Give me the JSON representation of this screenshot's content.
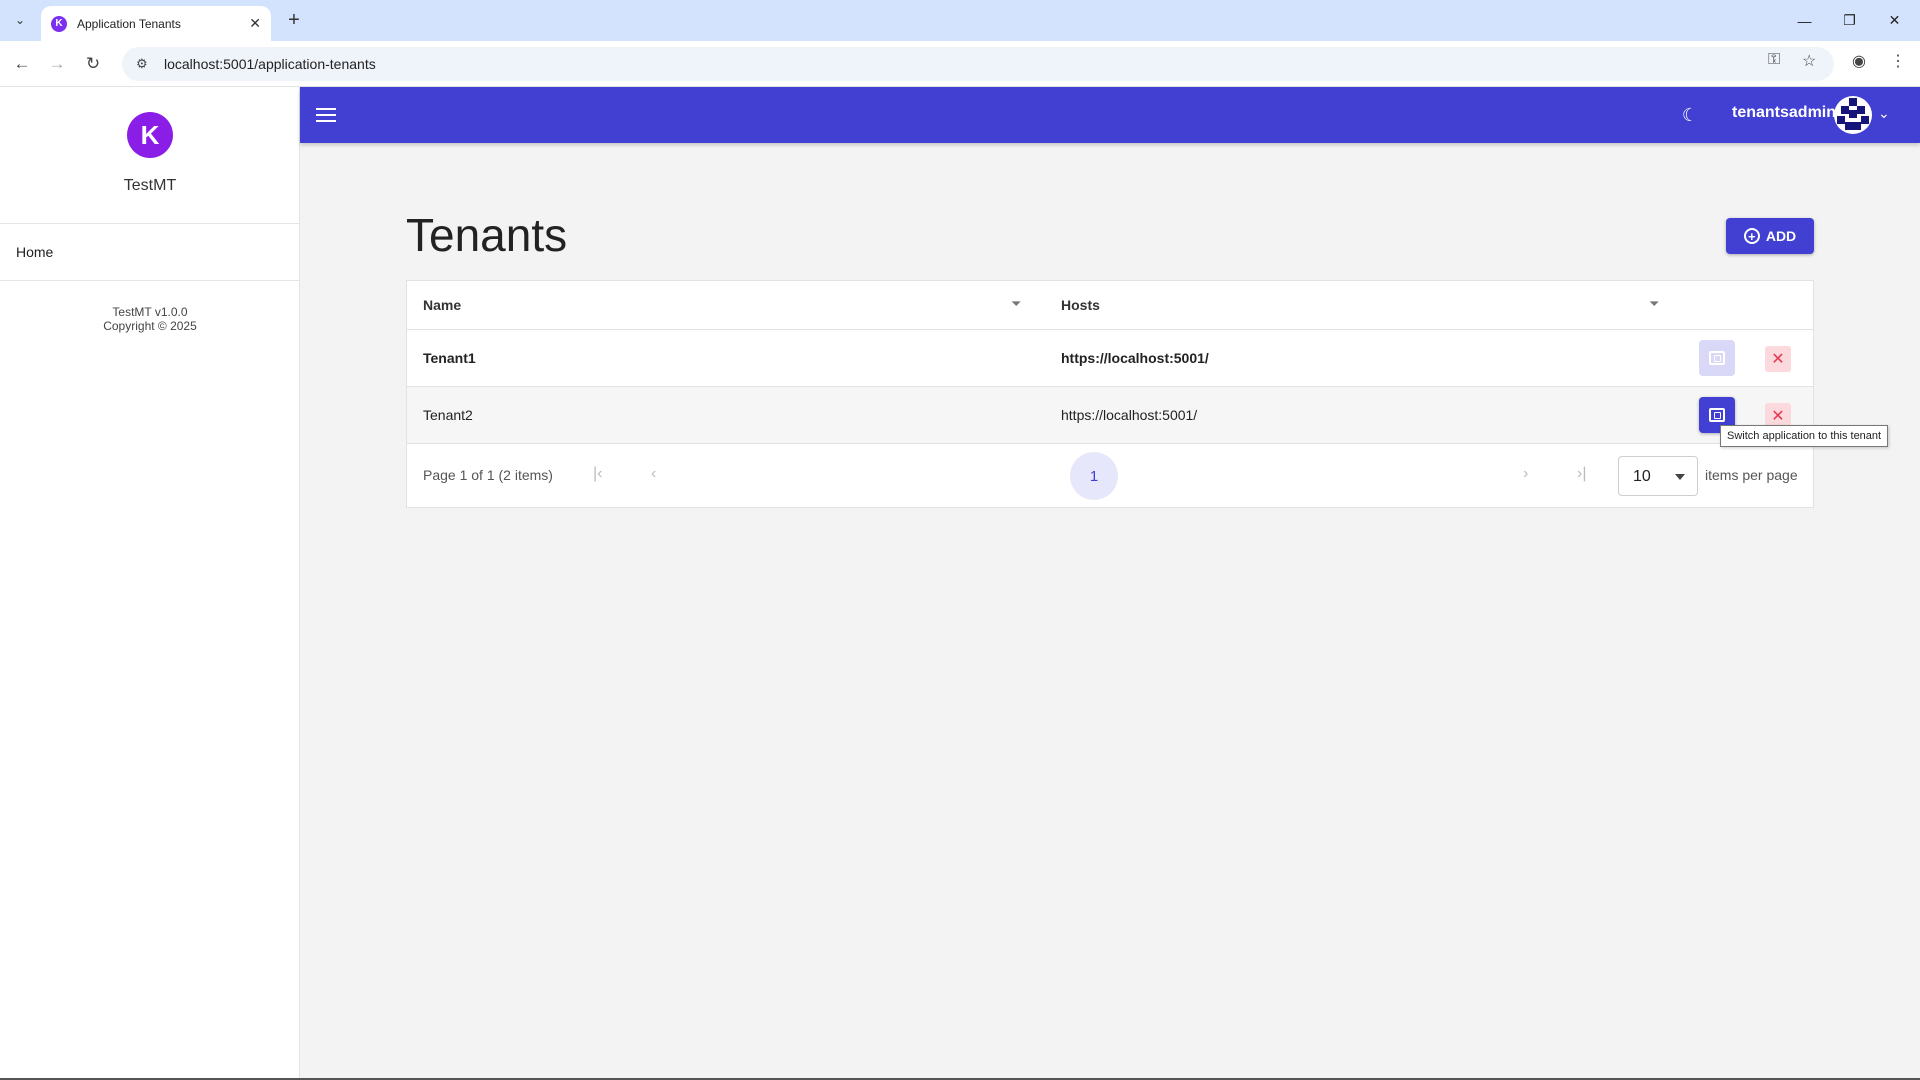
{
  "browser": {
    "tab_title": "Application Tenants",
    "url": "localhost:5001/application-tenants"
  },
  "sidebar": {
    "app_name": "TestMT",
    "logo_letter": "K",
    "nav": [
      {
        "label": "Home"
      }
    ],
    "version": "TestMT v1.0.0",
    "copyright": "Copyright © 2025"
  },
  "appbar": {
    "username": "tenantsadmin",
    "accent_color": "#4140d3"
  },
  "main": {
    "title": "Tenants",
    "add_label": "ADD",
    "columns": [
      "Name",
      "Hosts"
    ],
    "rows": [
      {
        "name": "Tenant1",
        "host": "https://localhost:5001/",
        "current": true
      },
      {
        "name": "Tenant2",
        "host": "https://localhost:5001/",
        "current": false
      }
    ],
    "pager": {
      "info": "Page 1 of 1 (2 items)",
      "current_page": "1",
      "page_size": "10",
      "per_page_label": "items per page"
    },
    "tooltip": "Switch application to this tenant"
  }
}
